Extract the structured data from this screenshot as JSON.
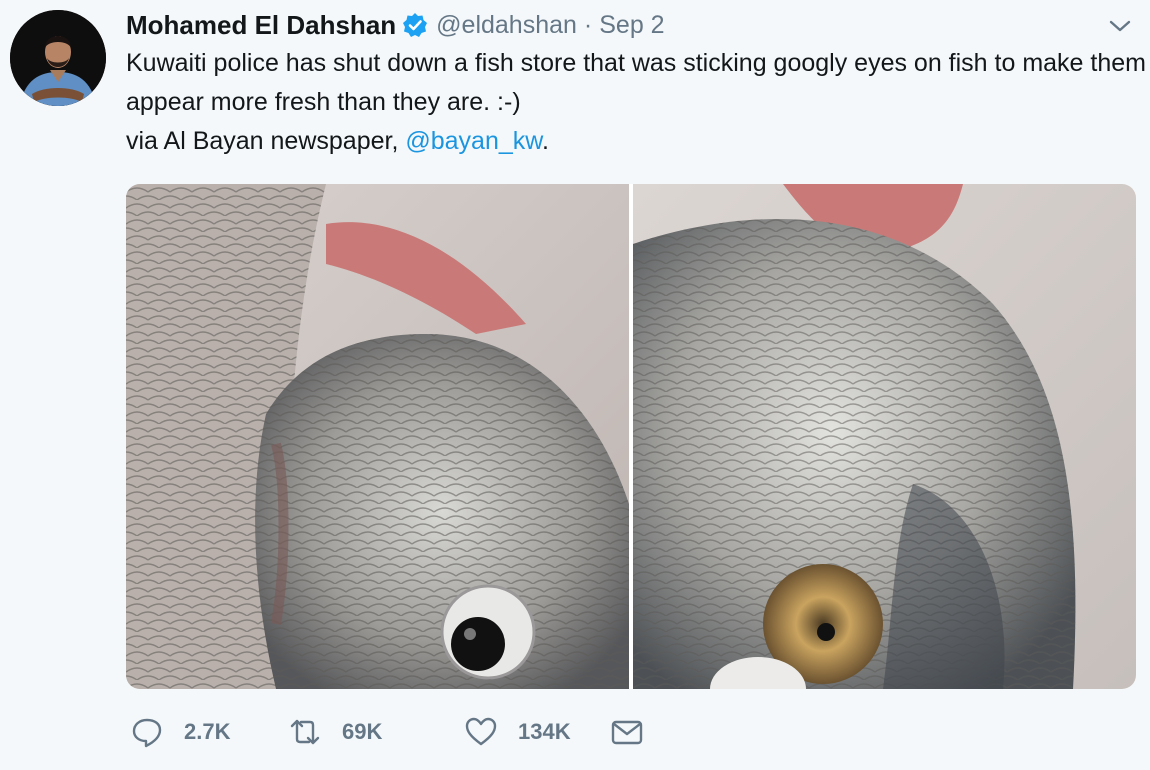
{
  "tweet": {
    "author_name": "Mohamed El Dahshan",
    "handle": "@eldahshan",
    "separator": "·",
    "date": "Sep 2",
    "text_line1": "Kuwaiti police has shut down a fish store that was sticking googly eyes on fish to make them appear more fresh than they are. :-)",
    "text_line2_prefix": "via Al Bayan newspaper, ",
    "mention": "@bayan_kw",
    "text_line2_suffix": "."
  },
  "actions": {
    "replies": "2.7K",
    "retweets": "69K",
    "likes": "134K"
  },
  "icons": {
    "verified": "verified-badge-icon",
    "caret": "chevron-down-icon",
    "reply": "reply-bubble-icon",
    "retweet": "retweet-icon",
    "like": "heart-icon",
    "dm": "envelope-icon"
  },
  "colors": {
    "background": "#f5f8fa",
    "text": "#14171a",
    "muted": "#657786",
    "link": "#1b95e0",
    "verified": "#1da1f2"
  }
}
